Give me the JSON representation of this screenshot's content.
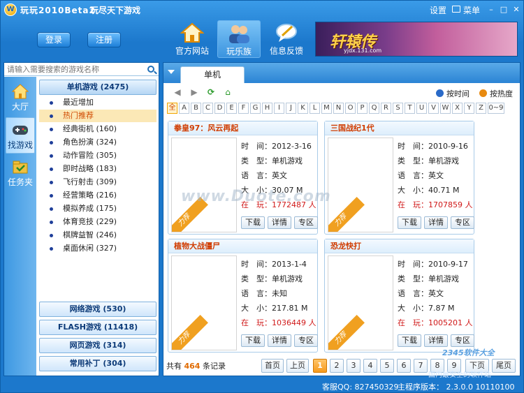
{
  "titlebar": {
    "app_title": "玩玩2010Beta2",
    "slogan": "玩尽天下游戏",
    "settings": "设置",
    "menu": "菜单"
  },
  "header": {
    "login": "登录",
    "register": "注册",
    "nav": [
      {
        "label": "官方网站"
      },
      {
        "label": "玩乐族"
      },
      {
        "label": "信息反馈"
      }
    ],
    "banner_text": "轩辕传",
    "banner_url": "yjdx.131.com"
  },
  "search": {
    "placeholder": "请输入需要搜索的游戏名称"
  },
  "sidenav": [
    {
      "label": "大厅"
    },
    {
      "label": "找游戏"
    },
    {
      "label": "任务夹"
    }
  ],
  "categories": {
    "open": "单机游戏 (2475)",
    "items": [
      {
        "label": "最近增加"
      },
      {
        "label": "热门推荐"
      },
      {
        "label": "经典街机 (160)"
      },
      {
        "label": "角色扮演 (324)"
      },
      {
        "label": "动作冒险 (305)"
      },
      {
        "label": "即时战略 (183)"
      },
      {
        "label": "飞行射击 (309)"
      },
      {
        "label": "经营策略 (216)"
      },
      {
        "label": "模拟养成 (175)"
      },
      {
        "label": "体育竞技 (229)"
      },
      {
        "label": "棋牌益智 (246)"
      },
      {
        "label": "桌面休闲 (327)"
      }
    ],
    "others": [
      {
        "label": "网络游戏 (530)"
      },
      {
        "label": "FLASH游戏 (11418)"
      },
      {
        "label": "网页游戏 (314)"
      },
      {
        "label": "常用补丁 (304)"
      }
    ]
  },
  "tab": {
    "label": "单机"
  },
  "sort": {
    "time": "按时间",
    "hot": "按热度"
  },
  "letters": [
    "全",
    "A",
    "B",
    "C",
    "D",
    "E",
    "F",
    "G",
    "H",
    "I",
    "J",
    "K",
    "L",
    "M",
    "N",
    "O",
    "P",
    "Q",
    "R",
    "S",
    "T",
    "U",
    "V",
    "W",
    "X",
    "Y",
    "Z",
    "0~9"
  ],
  "labels": {
    "time": "时　间：",
    "type": "类　型：",
    "lang": "语　言：",
    "size": "大　小：",
    "playing": "在　玩：",
    "badge": "力荐",
    "download": "下载",
    "detail": "详情",
    "zone": "专区"
  },
  "games": [
    {
      "title": "拳皇97：风云再起",
      "time": "2012-3-16",
      "type": "单机游戏",
      "lang": "英文",
      "size": "30.07 M",
      "playing": "1772487 人"
    },
    {
      "title": "三国战纪1代",
      "time": "2010-9-16",
      "type": "单机游戏",
      "lang": "英文",
      "size": "40.71 M",
      "playing": "1707859 人"
    },
    {
      "title": "植物大战僵尸",
      "time": "2013-1-4",
      "type": "单机游戏",
      "lang": "未知",
      "size": "217.81 M",
      "playing": "1036449 人"
    },
    {
      "title": "恐龙快打",
      "time": "2010-9-17",
      "type": "单机游戏",
      "lang": "英文",
      "size": "7.87 M",
      "playing": "1005201 人"
    }
  ],
  "pager": {
    "prefix": "共有",
    "count": "464",
    "suffix": "条记录",
    "first": "首页",
    "prev": "上页",
    "pages": [
      "1",
      "2",
      "3",
      "4",
      "5",
      "6",
      "7",
      "8",
      "9"
    ],
    "next": "下页",
    "last": "尾页",
    "current": "1"
  },
  "status": {
    "qq": "客服QQ:  827450329",
    "version": "主程序版本：  2.3.0.0  10110100"
  },
  "watermarks": {
    "center": "www.Duote.com",
    "corner": "2345软件大全",
    "corner_sub": "国内最安全的软件站"
  },
  "colors": {
    "accent": "#1c78cc",
    "highlight": "#d04a00",
    "red": "#d01818"
  }
}
